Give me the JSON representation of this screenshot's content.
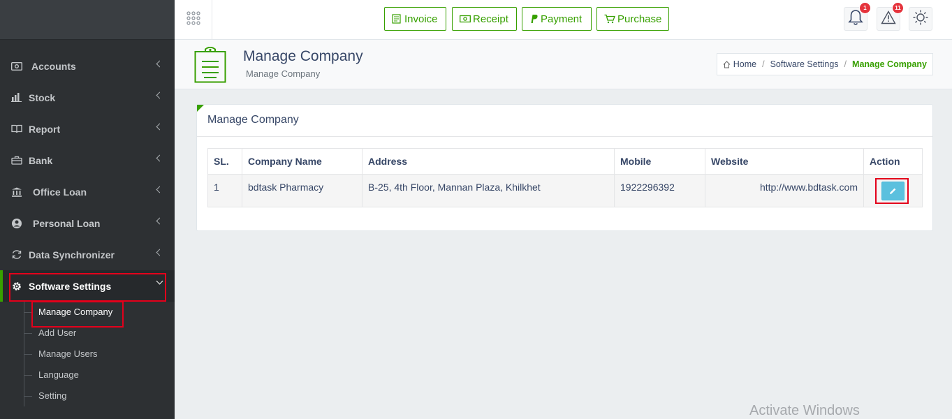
{
  "sidebar": {
    "items": [
      {
        "label": "Accounts",
        "icon": "money-icon"
      },
      {
        "label": "Stock",
        "icon": "bar-chart-icon"
      },
      {
        "label": "Report",
        "icon": "book-icon"
      },
      {
        "label": "Bank",
        "icon": "bank-bag-icon"
      },
      {
        "label": "Office Loan",
        "icon": "institution-icon"
      },
      {
        "label": "Personal Loan",
        "icon": "user-circle-icon"
      },
      {
        "label": "Data Synchronizer",
        "icon": "sync-icon"
      },
      {
        "label": "Software Settings",
        "icon": "gear-icon"
      }
    ],
    "submenu": [
      "Manage Company",
      "Add User",
      "Manage Users",
      "Language",
      "Setting"
    ]
  },
  "topbar": {
    "quick_buttons": [
      "Invoice",
      "Receipt",
      "Payment",
      "Purchase"
    ],
    "notification_count": "1",
    "alert_count": "11"
  },
  "header": {
    "title": "Manage Company",
    "subtitle": "Manage Company",
    "breadcrumb": [
      "Home",
      "Software Settings",
      "Manage Company"
    ]
  },
  "panel": {
    "title": "Manage Company",
    "columns": [
      "SL.",
      "Company Name",
      "Address",
      "Mobile",
      "Website",
      "Action"
    ],
    "rows": [
      {
        "sl": "1",
        "name": "bdtask Pharmacy",
        "address": "B-25, 4th Floor, Mannan Plaza, Khilkhet",
        "mobile": "1922296392",
        "website": "http://www.bdtask.com"
      }
    ]
  },
  "watermark": "Activate Windows",
  "colors": {
    "accent": "#37a000",
    "sidebar": "#2d3033",
    "highlight": "#e3001b",
    "edit": "#5bc0de"
  }
}
